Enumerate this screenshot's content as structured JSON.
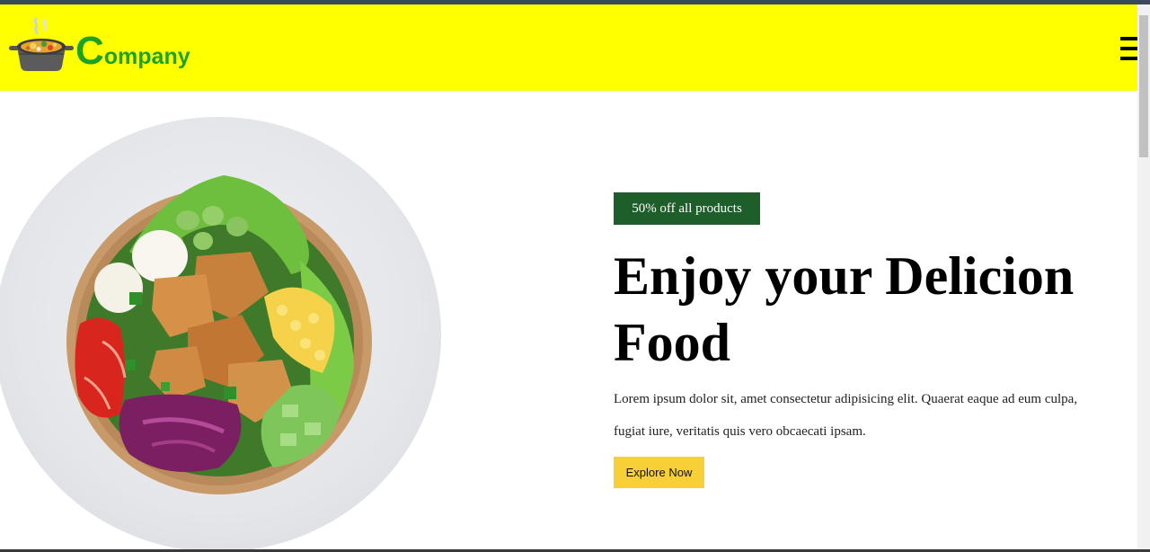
{
  "brand": {
    "logo_first_letter": "C",
    "logo_rest": "ompany",
    "logo_color": "#1fa31f",
    "logo_icon": "cooking-pot-icon"
  },
  "header": {
    "background_color": "#ffff00",
    "menu_icon": "hamburger-menu-icon"
  },
  "hero": {
    "image": "salad-bowl-image",
    "promo_label": "50% off all products",
    "promo_color": "#1e5e2a",
    "title": "Enjoy your Delicion Food",
    "description": "Lorem ipsum dolor sit, amet consectetur adipisicing elit. Quaerat eaque ad eum culpa, fugiat iure, veritatis quis vero obcaecati ipsam.",
    "cta_label": "Explore Now",
    "cta_color": "#f7cf36"
  }
}
